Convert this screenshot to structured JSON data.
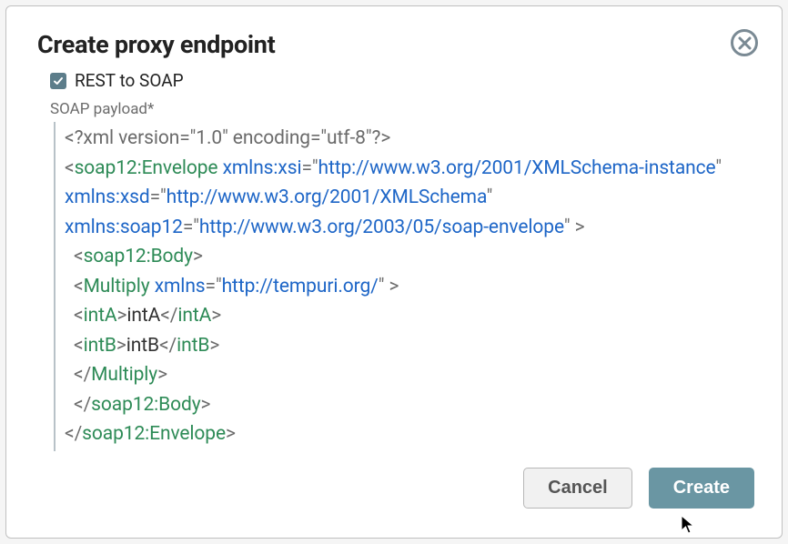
{
  "modal": {
    "title": "Create proxy endpoint",
    "checkbox_label": "REST to SOAP",
    "field_label": "SOAP payload*",
    "cancel_label": "Cancel",
    "create_label": "Create",
    "checkbox_checked": true
  },
  "soap_payload": {
    "xml_decl": "<?xml version=\"1.0\" encoding=\"utf-8\"?>",
    "envelope_tag": "soap12:Envelope",
    "envelope_attrs": {
      "xmlns:xsi": "http://www.w3.org/2001/XMLSchema-instance",
      "xmlns:xsd": "http://www.w3.org/2001/XMLSchema",
      "xmlns:soap12": "http://www.w3.org/2003/05/soap-envelope"
    },
    "body_tag": "soap12:Body",
    "operation": {
      "name": "Multiply",
      "xmlns": "http://tempuri.org/",
      "params": [
        {
          "tag": "intA",
          "value": "intA"
        },
        {
          "tag": "intB",
          "value": "intB"
        }
      ]
    }
  }
}
